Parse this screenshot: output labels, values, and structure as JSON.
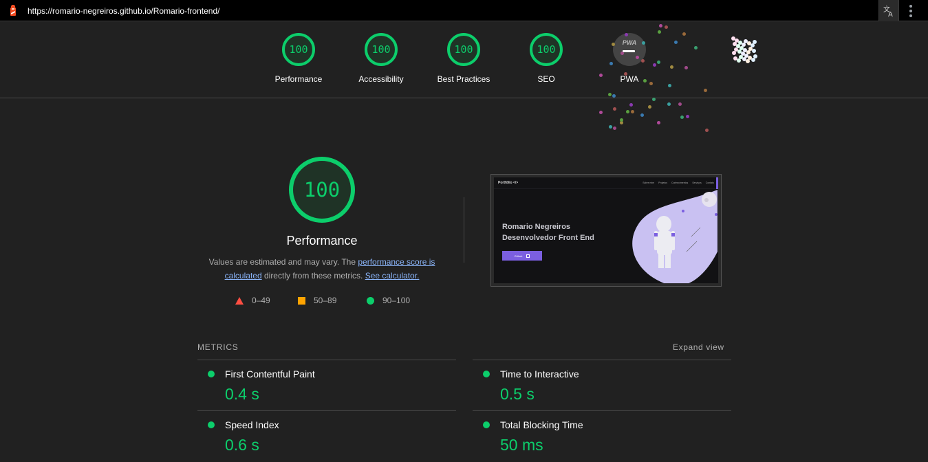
{
  "topbar": {
    "url": "https://romario-negreiros.github.io/Romario-frontend/",
    "logo_icon": "lighthouse-icon",
    "translate_icon": "translate-icon",
    "menu_icon": "more-vert-icon"
  },
  "header_scores": [
    {
      "label": "Performance",
      "score": "100"
    },
    {
      "label": "Accessibility",
      "score": "100"
    },
    {
      "label": "Best Practices",
      "score": "100"
    },
    {
      "label": "SEO",
      "score": "100"
    },
    {
      "label": "PWA",
      "score": "",
      "badge": "PWA"
    }
  ],
  "colors": {
    "pass": "#0cce6b",
    "average": "#ffa400",
    "fail": "#ff4e42",
    "link": "#8ab4f8",
    "background": "#212121"
  },
  "performance": {
    "score": "100",
    "title": "Performance",
    "desc_prefix": "Values are estimated and may vary. The ",
    "desc_link1": "performance score is calculated",
    "desc_middle": " directly from these metrics. ",
    "desc_link2": "See calculator.",
    "legend": [
      {
        "range": "0–49",
        "icon": "fail-triangle-icon"
      },
      {
        "range": "50–89",
        "icon": "average-square-icon"
      },
      {
        "range": "90–100",
        "icon": "pass-circle-icon"
      }
    ]
  },
  "screenshot": {
    "brand": "Portfólio </>",
    "nav": [
      "Sobre mim",
      "Projetos",
      "Conhecimentos",
      "Serviços",
      "Contato"
    ],
    "hero_line1": "Romario Negreiros",
    "hero_line2": "Desenvolvedor Front End",
    "button": "Github"
  },
  "metrics": {
    "title": "METRICS",
    "expand_label": "Expand view",
    "items": [
      {
        "name": "First Contentful Paint",
        "value": "0.4 s"
      },
      {
        "name": "Time to Interactive",
        "value": "0.5 s"
      },
      {
        "name": "Speed Index",
        "value": "0.6 s"
      },
      {
        "name": "Total Blocking Time",
        "value": "50 ms"
      }
    ]
  }
}
